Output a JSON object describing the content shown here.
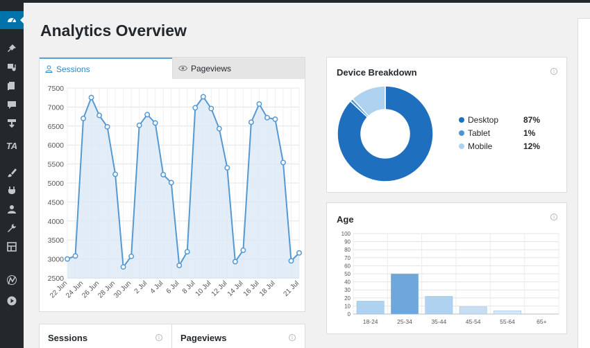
{
  "page": {
    "title": "Analytics Overview"
  },
  "sidebar": {
    "items": [
      {
        "icon": "dashboard-icon",
        "active": true
      },
      {
        "icon": "pin-icon"
      },
      {
        "icon": "media-icon"
      },
      {
        "icon": "pages-icon"
      },
      {
        "icon": "comments-icon"
      },
      {
        "icon": "download-icon"
      },
      {
        "icon": "text-logo-icon",
        "text": "TA"
      },
      {
        "icon": "brush-icon"
      },
      {
        "icon": "plugin-icon"
      },
      {
        "icon": "users-icon"
      },
      {
        "icon": "wrench-icon"
      },
      {
        "icon": "layout-icon"
      },
      {
        "icon": "analytics-icon"
      },
      {
        "icon": "play-icon"
      }
    ]
  },
  "traffic": {
    "tabs": [
      {
        "label": "Sessions",
        "icon": "user-icon",
        "active": true
      },
      {
        "label": "Pageviews",
        "icon": "eye-icon",
        "active": false
      }
    ]
  },
  "device": {
    "title": "Device Breakdown",
    "legend": [
      {
        "label": "Desktop",
        "value": "87%",
        "color": "#1f6fbf"
      },
      {
        "label": "Tablet",
        "value": "1%",
        "color": "#4a97d8"
      },
      {
        "label": "Mobile",
        "value": "12%",
        "color": "#aed2f0"
      }
    ]
  },
  "age": {
    "title": "Age"
  },
  "tiles": {
    "sessions": "Sessions",
    "pageviews": "Pageviews"
  },
  "colors": {
    "accent": "#0073aa",
    "line": "#5499d2",
    "fill": "#dbe9f6"
  },
  "chart_data": [
    {
      "type": "line",
      "x": [
        "22 Jun",
        "23 Jun",
        "24 Jun",
        "25 Jun",
        "26 Jun",
        "27 Jun",
        "28 Jun",
        "29 Jun",
        "30 Jun",
        "1 Jul",
        "2 Jul",
        "3 Jul",
        "4 Jul",
        "5 Jul",
        "6 Jul",
        "7 Jul",
        "8 Jul",
        "9 Jul",
        "10 Jul",
        "11 Jul",
        "12 Jul",
        "13 Jul",
        "14 Jul",
        "15 Jul",
        "16 Jul",
        "17 Jul",
        "18 Jul",
        "19 Jul",
        "20 Jul",
        "21 Jul"
      ],
      "tick_labels": [
        "22 Jun",
        "24 Jun",
        "26 Jun",
        "28 Jun",
        "30 Jun",
        "2 Jul",
        "4 Jul",
        "6 Jul",
        "8 Jul",
        "10 Jul",
        "12 Jul",
        "14 Jul",
        "16 Jul",
        "18 Jul",
        "21 Jul"
      ],
      "series": [
        {
          "values": [
            3000,
            3080,
            6700,
            7250,
            6780,
            6480,
            5230,
            2790,
            3070,
            6520,
            6800,
            6580,
            5220,
            5010,
            2830,
            3190,
            6980,
            7270,
            6960,
            6430,
            5400,
            2930,
            3230,
            6600,
            7080,
            6720,
            6680,
            5540,
            2950,
            3160
          ]
        }
      ],
      "yticks": [
        2500,
        3000,
        3500,
        4000,
        4500,
        5000,
        5500,
        6000,
        6500,
        7000,
        7500
      ],
      "ylim": [
        2500,
        7500
      ],
      "grid": true
    },
    {
      "type": "pie",
      "categories": [
        "Desktop",
        "Tablet",
        "Mobile"
      ],
      "values": [
        87,
        1,
        12
      ],
      "donut": true
    },
    {
      "type": "bar",
      "categories": [
        "18-24",
        "25-34",
        "35-44",
        "45-54",
        "55-64",
        "65+"
      ],
      "values": [
        16,
        50,
        22,
        9,
        4,
        0
      ],
      "yticks": [
        0,
        10,
        20,
        30,
        40,
        50,
        60,
        70,
        80,
        90,
        100
      ],
      "ylim": [
        0,
        100
      ],
      "grid": true
    }
  ]
}
